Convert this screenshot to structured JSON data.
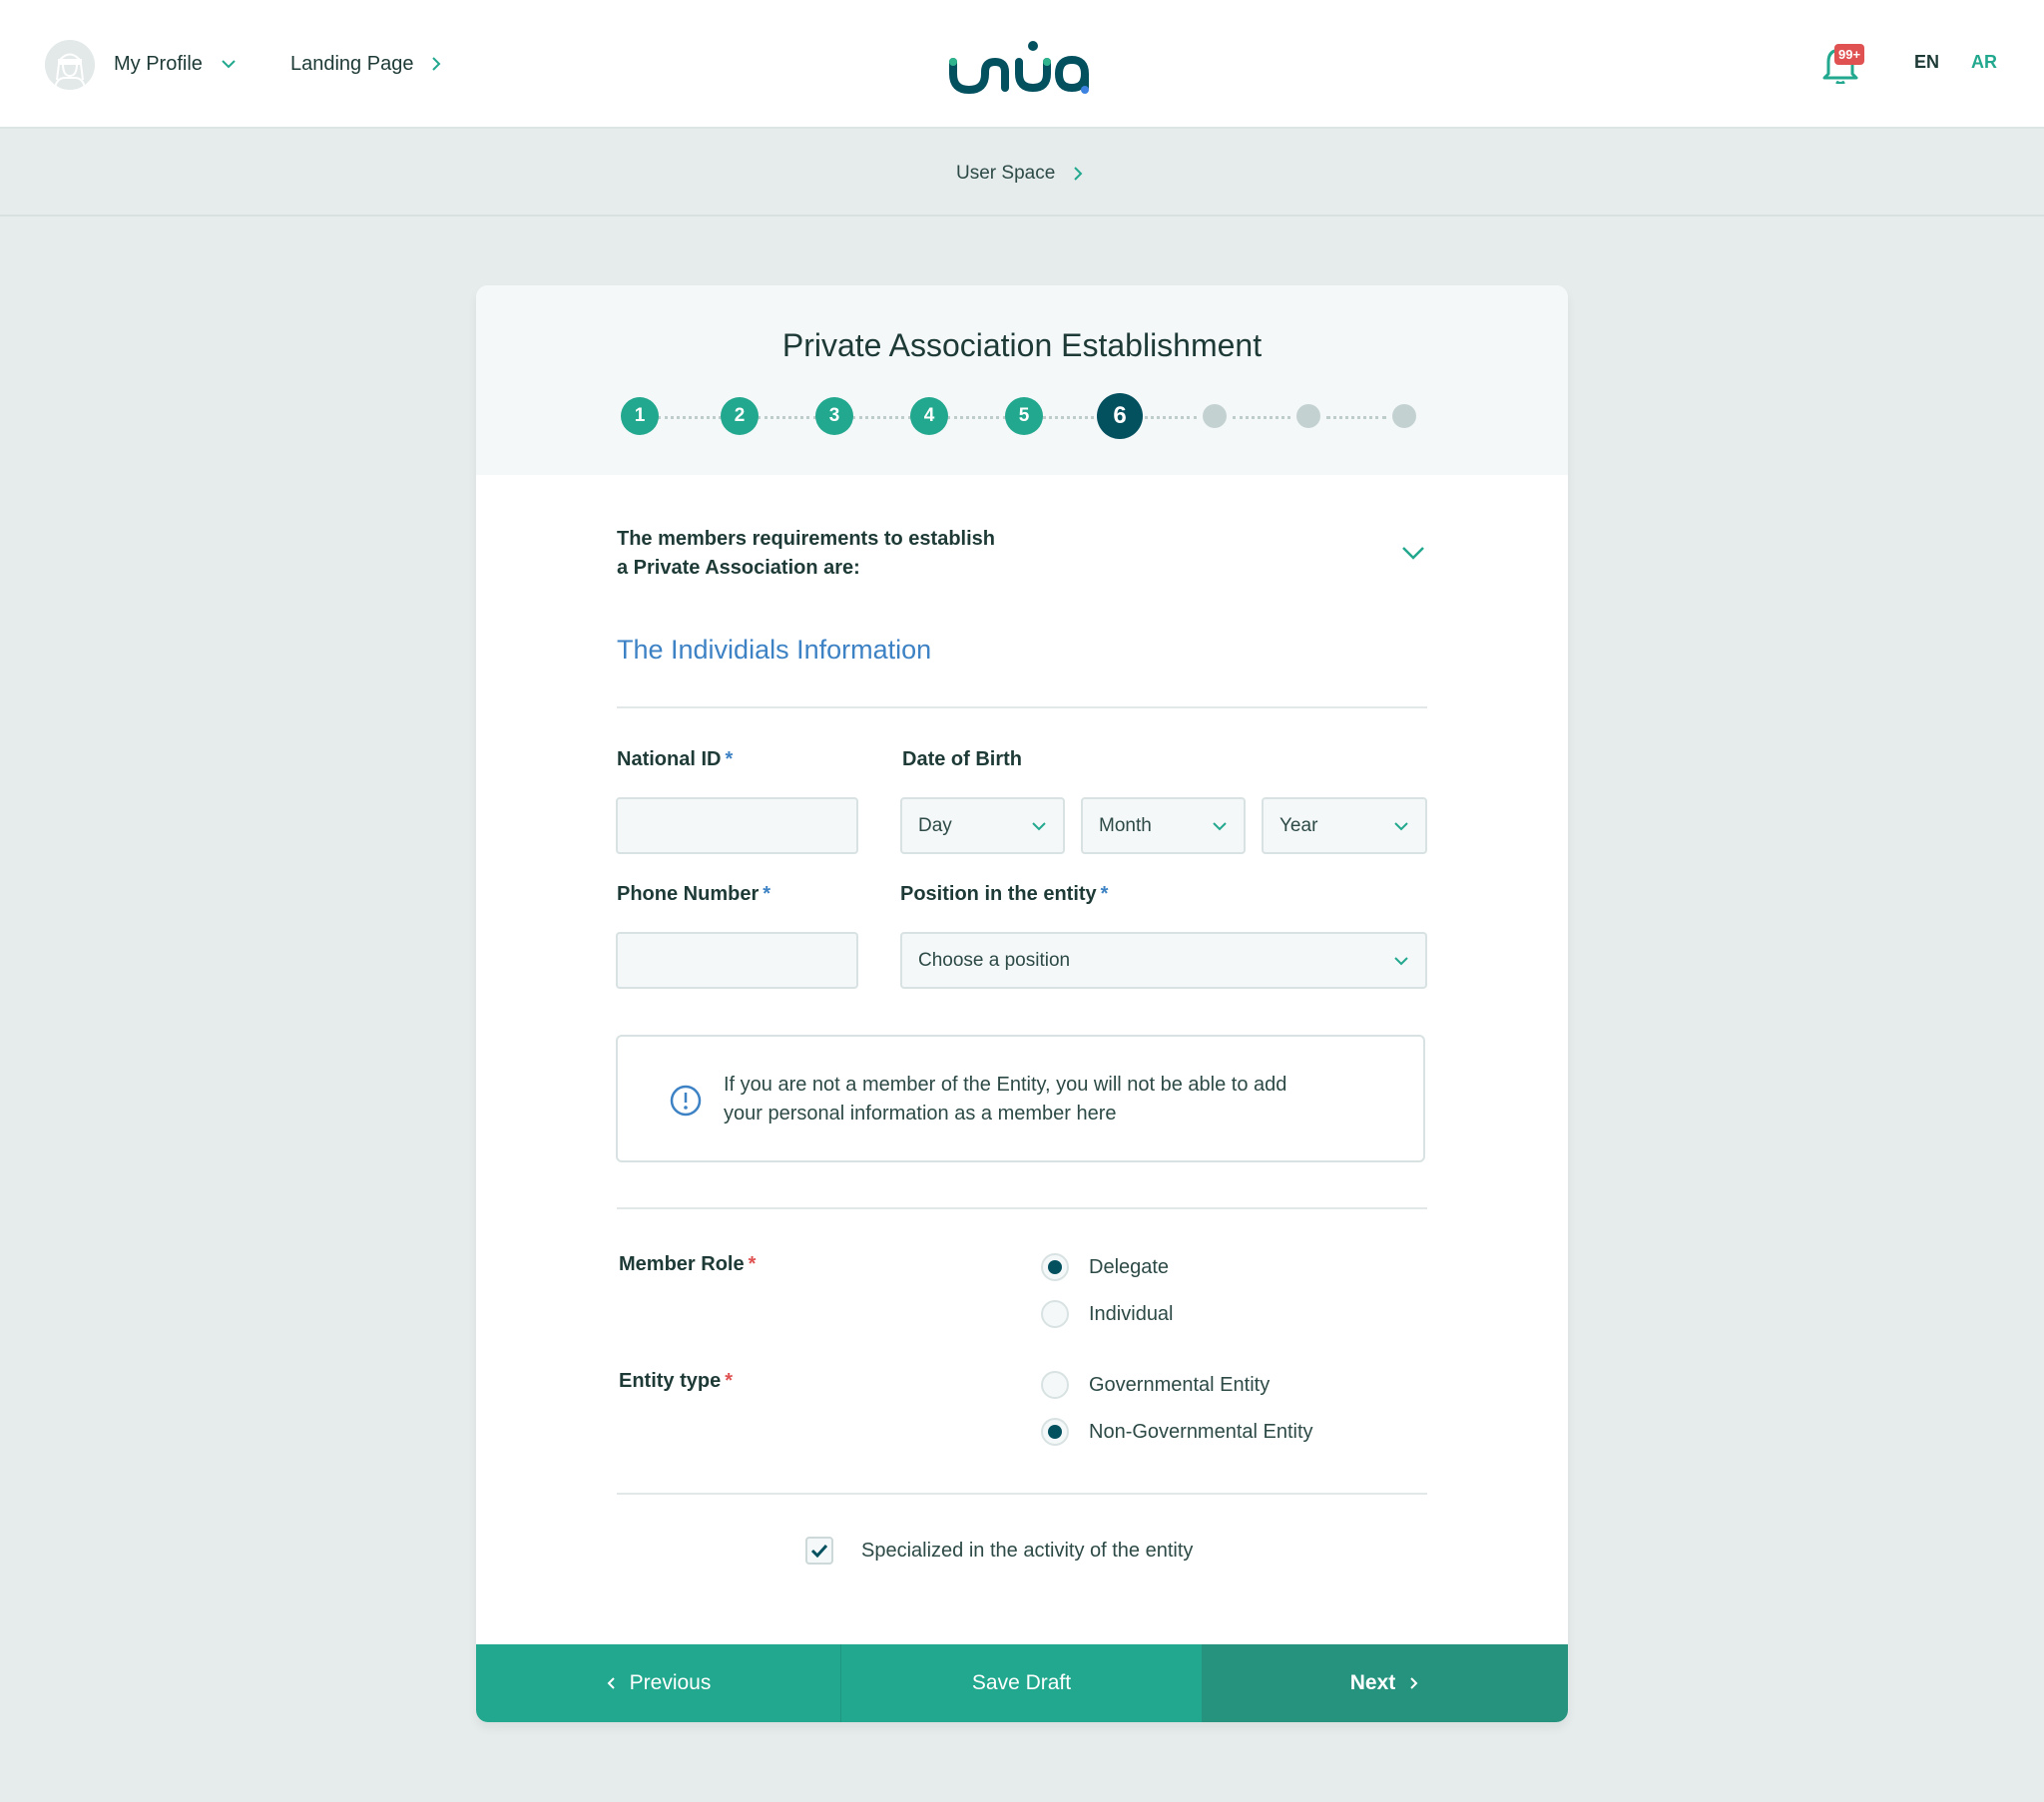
{
  "header": {
    "profile_label": "My Profile",
    "landing_label": "Landing Page",
    "logo_alt": "unuq",
    "notification_count": "99+",
    "lang_en": "EN",
    "lang_ar": "AR"
  },
  "breadcrumb": {
    "current": "User Space"
  },
  "form": {
    "title": "Private Association Establishment",
    "steps": [
      {
        "label": "1",
        "state": "done"
      },
      {
        "label": "2",
        "state": "done"
      },
      {
        "label": "3",
        "state": "done"
      },
      {
        "label": "4",
        "state": "done"
      },
      {
        "label": "5",
        "state": "done"
      },
      {
        "label": "6",
        "state": "current"
      },
      {
        "label": "",
        "state": "pending"
      },
      {
        "label": "",
        "state": "pending"
      },
      {
        "label": "",
        "state": "pending"
      }
    ],
    "requirements_line1": "The members requirements to establish",
    "requirements_line2": "a Private Association are:",
    "section_title": "The Individials Information",
    "national_id_label": "National ID",
    "national_id_value": "",
    "dob_label": "Date of Birth",
    "dob_day": "Day",
    "dob_month": "Month",
    "dob_year": "Year",
    "phone_label": "Phone Number",
    "phone_value": "",
    "position_label": "Position in the entity",
    "position_placeholder": "Choose a position",
    "required_mark": "*",
    "info_line1": "If you are not a member of the Entity, you will not be able to add",
    "info_line2": "your personal information as a member here",
    "member_role_label": "Member Role",
    "member_role_options": [
      {
        "label": "Delegate",
        "selected": true
      },
      {
        "label": "Individual",
        "selected": false
      }
    ],
    "entity_type_label": "Entity type",
    "entity_type_options": [
      {
        "label": "Governmental Entity",
        "selected": false
      },
      {
        "label": "Non-Governmental Entity",
        "selected": true
      }
    ],
    "specialized_label": "Specialized in the activity of the entity",
    "specialized_checked": true
  },
  "footer": {
    "previous_label": "Previous",
    "save_label": "Save Draft",
    "next_label": "Next"
  },
  "colors": {
    "primary": "#22a88e",
    "current_step": "#03505f",
    "accent_blue": "#3d82c4",
    "badge_red": "#e05252",
    "page_bg": "#e6ecec"
  }
}
